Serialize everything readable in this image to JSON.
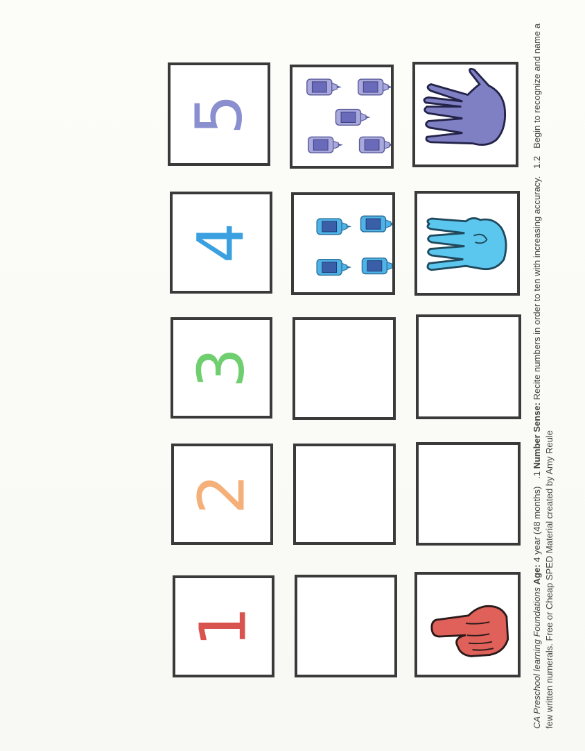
{
  "numerals": [
    {
      "value": "1",
      "color": "#d9534f"
    },
    {
      "value": "2",
      "color": "#f5b07a"
    },
    {
      "value": "3",
      "color": "#6fcf6f"
    },
    {
      "value": "4",
      "color": "#3aa0e0"
    },
    {
      "value": "5",
      "color": "#8a8fcf"
    }
  ],
  "counters": {
    "icon": "glue-bottle-icon",
    "counts": [
      0,
      0,
      0,
      4,
      5
    ],
    "colors": [
      "",
      "",
      "",
      "#4fb3e8",
      "#9a9ad6"
    ]
  },
  "hands": {
    "icon": "hand-fingers-icon",
    "counts": [
      1,
      0,
      0,
      4,
      5
    ],
    "colors": [
      "#e0605a",
      "",
      "",
      "#5cc7ee",
      "#7f7fc4"
    ]
  },
  "caption": {
    "program": "CA Preschool learning Foundations",
    "age_label": "Age:",
    "age_value": "4 year (48 months)",
    "section_number": ".1",
    "strand": "Number Sense:",
    "standard_text": "Recite numbers in order to ten with increasing accuracy.",
    "sub_number": "1.2",
    "sub_text": "Begin to recognize and name a few written numerals.",
    "credit": "Free or Cheap SPED Material created by Amy Reule"
  }
}
